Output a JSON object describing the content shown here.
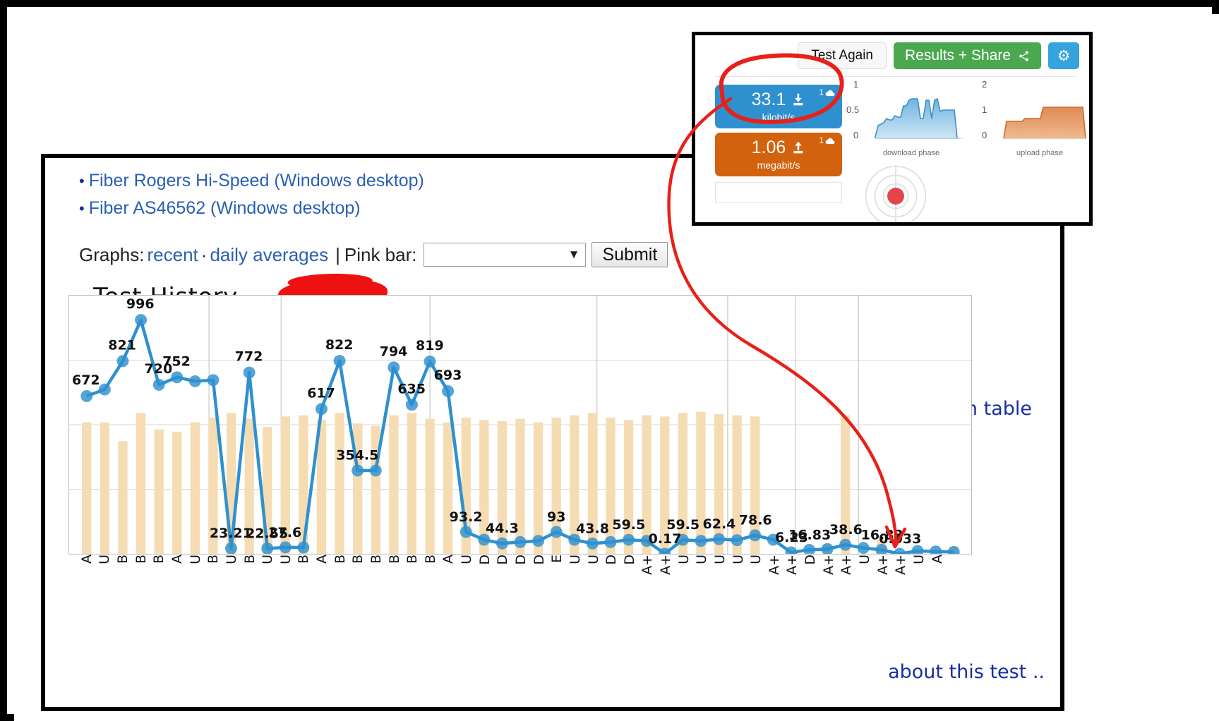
{
  "links": [
    {
      "label": "Fiber Rogers Hi-Speed (Windows desktop)"
    },
    {
      "label": "Fiber AS46562 (Windows desktop)"
    }
  ],
  "graphs_bar": {
    "prefix": "Graphs:",
    "recent": "recent",
    "separator": "·",
    "daily_averages": "daily averages",
    "pipe": "|",
    "pink_bar_label": "Pink bar:",
    "select_value": "",
    "select_caret": "▼",
    "submit_label": "Submit"
  },
  "chart_title": "Test History –",
  "see_full_data": "see full data in table",
  "about_test": "about this test ..",
  "widget": {
    "test_again": "Test Again",
    "results_share": "Results + Share",
    "share_icon": "share-icon",
    "gear_icon": "⚙",
    "download": {
      "value": "33.1",
      "unit": "kilobit/s",
      "badge": "1",
      "icon": "download-icon"
    },
    "upload": {
      "value": "1.06",
      "unit": "megabit/s",
      "badge": "1",
      "icon": "upload-icon"
    },
    "download_phase": {
      "label": "download phase",
      "yticks": [
        "1",
        "0.5",
        "0"
      ],
      "ymax": 1
    },
    "upload_phase": {
      "label": "upload phase",
      "yticks": [
        "2",
        "1",
        "0"
      ],
      "ymax": 2
    }
  },
  "chart_data": {
    "type": "line",
    "title": "Test History –",
    "xlabel": "",
    "ylabel": "",
    "grid": true,
    "legend": "none",
    "ylim": [
      0,
      1100
    ],
    "series": [
      {
        "name": "speed",
        "type": "line",
        "color": "#2f90cf",
        "values": [
          672,
          700,
          821,
          996,
          720,
          752,
          735,
          740,
          23.21,
          772,
          22.55,
          27.6,
          27.0,
          617,
          822,
          354.5,
          354.5,
          794,
          635,
          819,
          693,
          93.2,
          60,
          44.3,
          50,
          55,
          93,
          60,
          43.8,
          50,
          59.5,
          55,
          0.17,
          59.5,
          55,
          62.4,
          58,
          78.6,
          60,
          6.23,
          16.83,
          20,
          38.6,
          25,
          16.82,
          0.033,
          12,
          10,
          8
        ]
      },
      {
        "name": "pink bar",
        "type": "bar",
        "color": "#f5dcb3",
        "values": [
          560,
          560,
          480,
          600,
          530,
          520,
          560,
          580,
          600,
          575,
          540,
          585,
          590,
          570,
          600,
          555,
          545,
          590,
          600,
          575,
          560,
          580,
          570,
          565,
          575,
          560,
          580,
          590,
          600,
          580,
          570,
          590,
          585,
          600,
          605,
          595,
          590,
          585,
          0,
          0,
          0,
          40,
          590,
          0,
          60,
          0,
          0,
          0,
          30
        ]
      }
    ],
    "point_labels": [
      {
        "index": 0,
        "text": "672"
      },
      {
        "index": 2,
        "text": "821"
      },
      {
        "index": 3,
        "text": "996"
      },
      {
        "index": 4,
        "text": "720"
      },
      {
        "index": 5,
        "text": "752"
      },
      {
        "index": 8,
        "text": "23.21"
      },
      {
        "index": 9,
        "text": "772"
      },
      {
        "index": 10,
        "text": "22.55"
      },
      {
        "index": 11,
        "text": "27.6"
      },
      {
        "index": 13,
        "text": "617"
      },
      {
        "index": 14,
        "text": "822"
      },
      {
        "index": 15,
        "text": "354.5"
      },
      {
        "index": 17,
        "text": "794"
      },
      {
        "index": 18,
        "text": "635"
      },
      {
        "index": 19,
        "text": "819"
      },
      {
        "index": 20,
        "text": "693"
      },
      {
        "index": 21,
        "text": "93.2"
      },
      {
        "index": 23,
        "text": "44.3"
      },
      {
        "index": 26,
        "text": "93"
      },
      {
        "index": 28,
        "text": "43.8"
      },
      {
        "index": 30,
        "text": "59.5"
      },
      {
        "index": 32,
        "text": "0.17"
      },
      {
        "index": 33,
        "text": "59.5"
      },
      {
        "index": 35,
        "text": "62.4"
      },
      {
        "index": 37,
        "text": "78.6"
      },
      {
        "index": 39,
        "text": "6.23"
      },
      {
        "index": 40,
        "text": "16.83"
      },
      {
        "index": 42,
        "text": "38.6"
      },
      {
        "index": 44,
        "text": "16.82"
      },
      {
        "index": 45,
        "text": "0.033"
      }
    ],
    "xticklabels": [
      "A",
      "U",
      "B",
      "B",
      "B",
      "A",
      "U",
      "B",
      "U",
      "B",
      "U",
      "U",
      "B",
      "A",
      "B",
      "B",
      "B",
      "B",
      "B",
      "B",
      "A",
      "U",
      "D",
      "D",
      "D",
      "D",
      "E",
      "U",
      "U",
      "D",
      "D",
      "A+",
      "A+",
      "U",
      "U",
      "U",
      "U",
      "U",
      "A+",
      "A+",
      "D",
      "A+",
      "A+",
      "U",
      "A+",
      "A+",
      "U",
      "A"
    ]
  }
}
